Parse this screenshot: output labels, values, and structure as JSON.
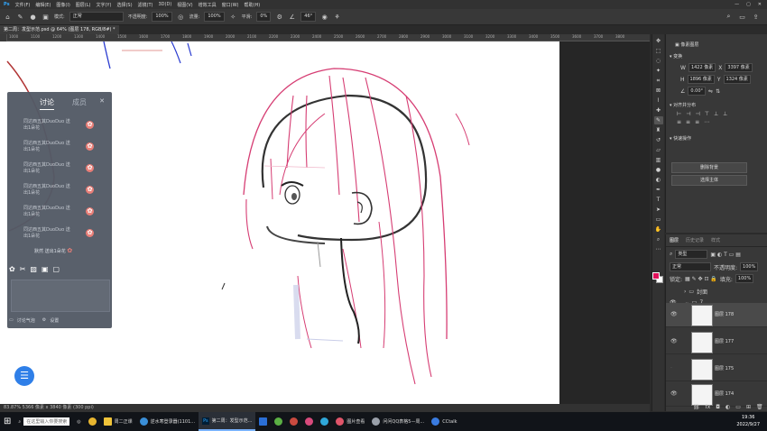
{
  "menubar": {
    "items": [
      "文件(F)",
      "编辑(E)",
      "图像(I)",
      "图层(L)",
      "文字(Y)",
      "选择(S)",
      "滤镜(T)",
      "3D(D)",
      "视图(V)",
      "增效工具",
      "窗口(W)",
      "帮助(H)"
    ]
  },
  "options": {
    "mode_label": "模式:",
    "mode_value": "正常",
    "opacity_label": "不透明度:",
    "opacity_value": "100%",
    "flow_label": "流量:",
    "flow_value": "100%",
    "smooth_label": "平滑:",
    "smooth_value": "0%",
    "angle_value": "46°"
  },
  "document": {
    "tab_title": "第二周：发型示范.psd @ 64% (图层 178, RGB/8#) *"
  },
  "ruler": {
    "ticks": [
      "1000",
      "1100",
      "1200",
      "1300",
      "1400",
      "1500",
      "1600",
      "1700",
      "1800",
      "1900",
      "2000",
      "2100",
      "2200",
      "2300",
      "2400",
      "2500",
      "2600",
      "2700",
      "2800",
      "2900",
      "3000",
      "3100",
      "3200",
      "3300",
      "3400",
      "3500",
      "3600",
      "3700",
      "3800"
    ]
  },
  "panel": {
    "tab_discuss": "讨论",
    "tab_score": "成员",
    "messages": [
      {
        "line1": "同达西五其DuoDuo 送",
        "line2": "出1朵花"
      },
      {
        "line1": "同达西五其DuoDuo 送",
        "line2": "出1朵花"
      },
      {
        "line1": "同达西五其DuoDuo 送",
        "line2": "出1朵花"
      },
      {
        "line1": "同达西五其DuoDuo 送",
        "line2": "出1朵花"
      },
      {
        "line1": "同达西五其DuoDuo 送",
        "line2": "出1朵花"
      },
      {
        "line1": "同达西五其DuoDuo 送",
        "line2": "出1朵花"
      }
    ],
    "send_summary": "默然 送出1朵花",
    "footer_discuss": "讨论气泡",
    "footer_settings": "设置"
  },
  "statusbar": {
    "text": "83.87%    5366 像素 x 3840 像素 (300 ppi)"
  },
  "properties": {
    "title": "像素图层",
    "transform_label": "变换",
    "w_value": "1422 像素",
    "h_value": "1896 像素",
    "x_value": "3397 像素",
    "y_value": "1324 像素",
    "angle_value": "0.00°",
    "align_label": "对齐并分布",
    "quick_label": "快速操作",
    "btn_remove_bg": "删除背景",
    "btn_select_subject": "选择主体"
  },
  "layers": {
    "tabs": [
      "图层",
      "历史记录",
      "样式"
    ],
    "kind_label": "类型",
    "blend_value": "正常",
    "opacity_label": "不透明度:",
    "opacity_value": "100%",
    "lock_label": "锁定:",
    "fill_label": "填充:",
    "fill_value": "100%",
    "group1": "封面",
    "group2": "7",
    "items": [
      {
        "name": "图层 178"
      },
      {
        "name": "图层 177"
      },
      {
        "name": "图层 175"
      },
      {
        "name": "图层 174"
      }
    ]
  },
  "taskbar": {
    "search_placeholder": "在这里输入你要搜索",
    "apps": [
      "周二正课",
      "逆水寒登录器(1101...",
      "第二周：发型示范...",
      "图片查看",
      "问问QQ表格5—周...",
      "CCtalk"
    ],
    "time": "19:36",
    "date": "2022/9/27"
  },
  "colors": {
    "accent": "#e0105a",
    "panel_bg": "#535a66",
    "bubble": "#2f7fe8"
  }
}
